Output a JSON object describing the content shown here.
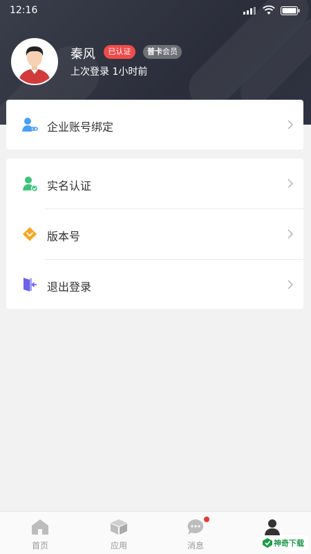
{
  "status_bar": {
    "time": "12:16"
  },
  "profile": {
    "name": "秦风",
    "verified_badge": "已认证",
    "member_badge_bold": "普卡",
    "member_badge_rest": "会员",
    "last_login": "上次登录 1小时前"
  },
  "menu": {
    "group1": [
      {
        "label": "企业账号绑定",
        "icon": "user-link-icon"
      }
    ],
    "group2": [
      {
        "label": "实名认证",
        "icon": "user-verified-icon"
      },
      {
        "label": "版本号",
        "icon": "diamond-icon"
      },
      {
        "label": "退出登录",
        "icon": "logout-door-icon"
      }
    ]
  },
  "tabbar": {
    "tabs": [
      {
        "label": "首页",
        "icon": "home-icon"
      },
      {
        "label": "应用",
        "icon": "box-icon"
      },
      {
        "label": "消息",
        "icon": "chat-icon",
        "badge": true
      },
      {
        "label": "",
        "icon": "profile-icon"
      }
    ]
  },
  "watermark": {
    "text": "神奇下载"
  },
  "colors": {
    "header_bg": "#2b2e3a",
    "verified": "#f04b4b",
    "member": "#6e7076",
    "accent_blue": "#4a9ff5",
    "accent_green": "#3ec27a",
    "accent_orange": "#f5a623",
    "accent_purple": "#6b63e8"
  }
}
